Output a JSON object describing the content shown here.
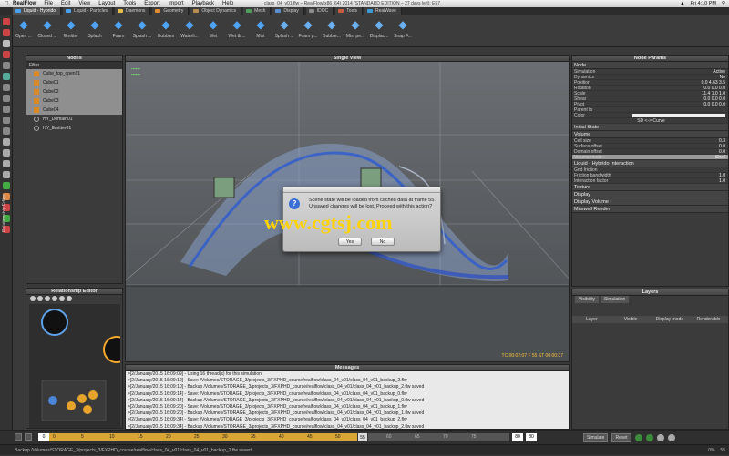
{
  "menubar": {
    "app": "RealFlow",
    "items": [
      "File",
      "Edit",
      "View",
      "Layout",
      "Tools",
      "Export",
      "Import",
      "Playback",
      "Help"
    ],
    "window_title": "class_04_v01.flw – RealFlow(x86_64) 2014 (STANDARD EDITION – 27 days left): E57",
    "clock": "Fri 4:10 PM"
  },
  "logo": "fxphd",
  "tabs": [
    {
      "label": "Liquid - Hybrido",
      "color": "#4aa3f0"
    },
    {
      "label": "Liquid - Particles",
      "color": "#4aa3f0"
    },
    {
      "label": "Daemons",
      "color": "#e6c04a"
    },
    {
      "label": "Geometry",
      "color": "#e28c2e"
    },
    {
      "label": "Object Dynamics",
      "color": "#b98d4e"
    },
    {
      "label": "Mesh",
      "color": "#4e9f5c"
    },
    {
      "label": "Display",
      "color": "#5b8fd0"
    },
    {
      "label": "IDOC",
      "color": "#8c8c8c"
    },
    {
      "label": "Tools",
      "color": "#c95c3a"
    },
    {
      "label": "RealWave",
      "color": "#3c9ad6"
    }
  ],
  "toolbar": [
    "Open ...",
    "Closed ...",
    "Emitter",
    "Splash",
    "Foam",
    "Splash ...",
    "Bubbles",
    "Waterli...",
    "Wet",
    "Wet & ...",
    "Mist",
    "Splash ...",
    "Foam p...",
    "Bubble...",
    "Mist pe...",
    "Displac...",
    "Snap F..."
  ],
  "nodes": {
    "title": "Nodes",
    "filter": "Filter",
    "items": [
      {
        "label": "Cube_top_open01",
        "type": "cube",
        "selected": true
      },
      {
        "label": "Cube01",
        "type": "cube",
        "selected": true
      },
      {
        "label": "Cube02",
        "type": "cube",
        "selected": true
      },
      {
        "label": "Cube03",
        "type": "cube",
        "selected": true
      },
      {
        "label": "Cube04",
        "type": "cube",
        "selected": true
      },
      {
        "label": "HY_Domain01",
        "type": "emitter",
        "selected": false
      },
      {
        "label": "HY_Emitter01",
        "type": "emitter",
        "selected": false
      }
    ]
  },
  "viewport": {
    "title": "Single View",
    "timecode": "TC 00:02:07   F 55   ST 00:00:37"
  },
  "dialog": {
    "icon": "?",
    "message": "Scene state will be loaded from cached data at frame 55. Unsaved changes will be lost. Proceed with this action?",
    "yes_label": "Yes",
    "no_label": "No"
  },
  "watermark": "www.cgtsj.com",
  "relationship": {
    "title": "Relationship Editor",
    "side_label": "Relationship Editor"
  },
  "params": {
    "title": "Node Params",
    "node_section": "Node",
    "rows": [
      {
        "k": "Simulation",
        "v": "Active"
      },
      {
        "k": "Dynamics",
        "v": "No"
      },
      {
        "k": "Position",
        "v": "0.0        4.63        3.5"
      },
      {
        "k": "Rotation",
        "v": "0.0        0.0        0.0"
      },
      {
        "k": "Scale",
        "v": "11.4        1.0        1.0"
      },
      {
        "k": "Shear",
        "v": "0.0        0.0        0.0"
      },
      {
        "k": "Pivot",
        "v": "0.0        0.0        0.0"
      },
      {
        "k": "Parent to",
        "v": ""
      }
    ],
    "color_label": "Color",
    "sd_curve": "SD <-> Curve",
    "initial_state": "Initial State",
    "volume": "Volume",
    "volume_rows": [
      {
        "k": "Cell size",
        "v": "0.3"
      },
      {
        "k": "Surface offset",
        "v": "0.0"
      },
      {
        "k": "Domain offset",
        "v": "0.0"
      },
      {
        "k": "Volume mode",
        "v": "Shell"
      }
    ],
    "interaction": "Liquid - Hybrido Interaction",
    "interaction_rows": [
      {
        "k": "Grid friction",
        "v": ""
      },
      {
        "k": "Friction bandwidth",
        "v": "1.0"
      },
      {
        "k": "Interaction factor",
        "v": "1.0"
      }
    ],
    "sections": [
      "Texture",
      "Display",
      "Display Volume",
      "Maxwell Render"
    ]
  },
  "layers": {
    "title": "Layers",
    "tabs": [
      "Visibility",
      "Simulation"
    ],
    "columns": [
      "Layer",
      "Visible",
      "Display mode",
      "Renderable"
    ]
  },
  "messages": {
    "title": "Messages",
    "lines": [
      ">[2/January/2015 16:09:09] - Using 16 thread(s) for this simulation.",
      ">[2/January/2015 16:09:10] - Save: /Volumes/STORAGE_3/projects_3/FXPHD_course/realflow/class_04_v01/class_04_v01_backup_2.flw",
      ">[2/January/2015 16:09:10] - Backup /Volumes/STORAGE_3/projects_3/FXPHD_course/realflow/class_04_v01/class_04_v01_backup_2.flw saved",
      ">[2/January/2015 16:09:14] - Save: /Volumes/STORAGE_3/projects_3/FXPHD_course/realflow/class_04_v01/class_04_v01_backup_0.flw",
      ">[2/January/2015 16:09:14] - Backup /Volumes/STORAGE_3/projects_3/FXPHD_course/realflow/class_04_v01/class_04_v01_backup_0.flw saved",
      ">[2/January/2015 16:09:20] - Save: /Volumes/STORAGE_3/projects_3/FXPHD_course/realflow/class_04_v01/class_04_v01_backup_1.flw",
      ">[2/January/2015 16:09:20] - Backup /Volumes/STORAGE_3/projects_3/FXPHD_course/realflow/class_04_v01/class_04_v01_backup_1.flw saved",
      ">[2/January/2015 16:09:34] - Save: /Volumes/STORAGE_3/projects_3/FXPHD_course/realflow/class_04_v01/class_04_v01_backup_2.flw",
      ">[2/January/2015 16:09:34] - Backup /Volumes/STORAGE_3/projects_3/FXPHD_course/realflow/class_04_v01/class_04_v01_backup_2.flw saved"
    ]
  },
  "timeline": {
    "start": "0",
    "ticks": [
      "0",
      "5",
      "10",
      "15",
      "20",
      "25",
      "30",
      "35",
      "40",
      "45",
      "50"
    ],
    "current": "55",
    "ticks2": [
      "60",
      "65",
      "70",
      "75"
    ],
    "end1": "80",
    "end2": "80",
    "simulate": "Simulate",
    "reset": "Reset",
    "frame": "55"
  },
  "status": {
    "text": "Backup /Volumes/STORAGE_3/projects_3/FXPHD_course/realflow/class_04_v01/class_04_v01_backup_2.flw saved",
    "percent": "0%"
  }
}
